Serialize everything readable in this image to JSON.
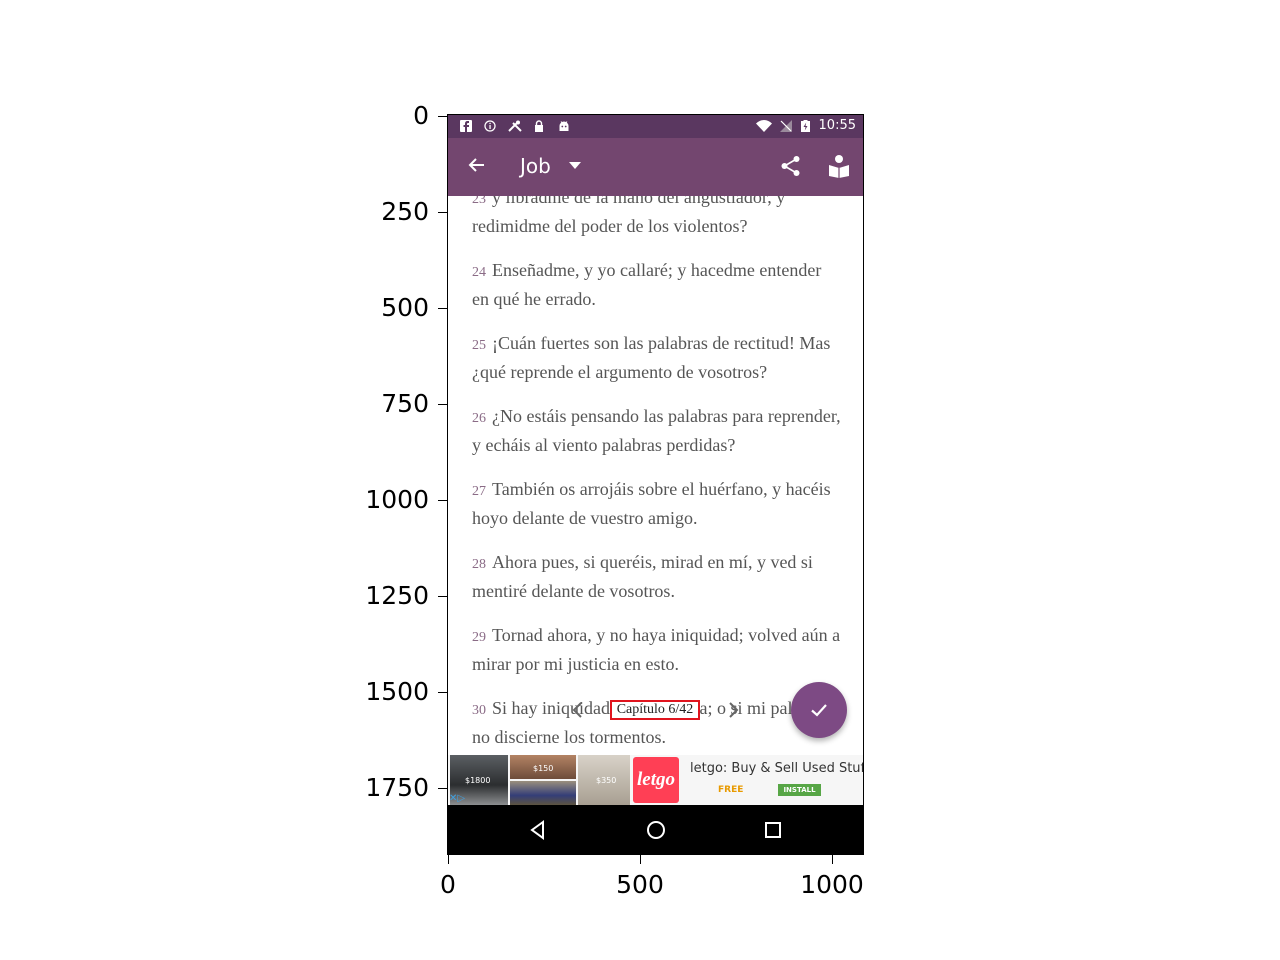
{
  "axes": {
    "y_ticks": [
      "0",
      "250",
      "500",
      "750",
      "1000",
      "1250",
      "1500",
      "1750"
    ],
    "x_ticks": [
      "0",
      "500",
      "1000"
    ]
  },
  "status_bar": {
    "time": "10:55",
    "left_icons": [
      "facebook-icon",
      "info-icon",
      "tools-icon",
      "lock-icon",
      "android-icon"
    ],
    "right_icons": [
      "wifi-icon",
      "no-signal-icon",
      "battery-charging-icon"
    ]
  },
  "app_bar": {
    "title": "Job",
    "icons": [
      "back-arrow-icon",
      "dropdown-caret-icon",
      "share-icon",
      "book-reader-icon"
    ],
    "color": "#73466f",
    "status_color": "#5a3760"
  },
  "verses": [
    {
      "num": "23",
      "text": "y libradme de la mano del angustiador, y redimidme del poder de los violentos?"
    },
    {
      "num": "24",
      "text": "Enseñadme, y yo callaré; y hacedme entender en qué he errado."
    },
    {
      "num": "25",
      "text": "¡Cuán fuertes son las palabras de rectitud! Mas ¿qué reprende el argumento de vosotros?"
    },
    {
      "num": "26",
      "text": "¿No estáis pensando las palabras para reprender, y echáis al viento palabras perdidas?"
    },
    {
      "num": "27",
      "text": "También os arrojáis sobre el huérfano, y hacéis hoyo delante de vuestro amigo."
    },
    {
      "num": "28",
      "text": "Ahora pues, si queréis, mirad en mí, y ved si mentiré delante de vosotros."
    },
    {
      "num": "29",
      "text": "Tornad ahora, y no haya iniquidad; volved aún a mirar por mi justicia en esto."
    },
    {
      "num": "30",
      "text": "Si hay iniquidad en mi lengua; o si mi paladar no discierne los tormentos."
    }
  ],
  "chapter_nav": {
    "label": "Capítulo 6/42",
    "fab_icon": "check-icon",
    "highlight_color": "#e0141e"
  },
  "ad": {
    "prices": [
      "$1800",
      "$150",
      "$350"
    ],
    "logo": "letgo",
    "title": "letgo: Buy & Sell Used Stuff",
    "free": "FREE",
    "install": "INSTALL"
  },
  "nav_bar": {
    "icons": [
      "back-triangle-icon",
      "home-circle-icon",
      "recents-square-icon"
    ]
  }
}
